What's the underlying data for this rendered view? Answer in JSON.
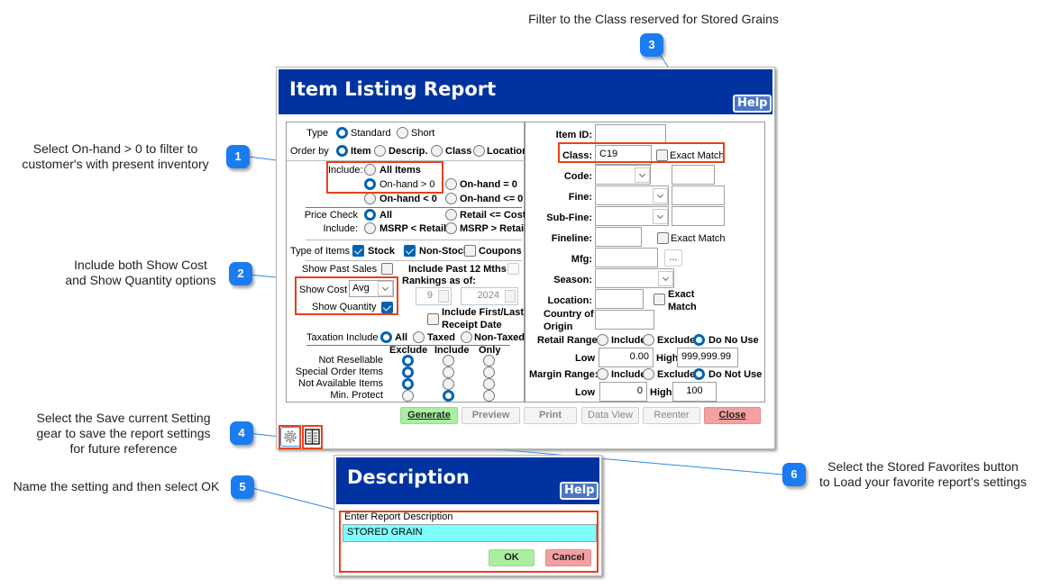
{
  "annotations": [
    {
      "number": "1",
      "text_line1": "Select On-hand > 0 to filter to",
      "text_line2": "customer's with present inventory"
    },
    {
      "number": "2",
      "text_line1": "Include both Show Cost",
      "text_line2": "and Show Quantity options"
    },
    {
      "number": "3",
      "text_line1": "Filter to the Class reserved for Stored Grains"
    },
    {
      "number": "4",
      "text_line1": "Select the Save current Setting",
      "text_line2": "gear to save the report settings",
      "text_line3": "for future reference"
    },
    {
      "number": "5",
      "text_line1": "Name the setting and then select OK"
    },
    {
      "number": "6",
      "text_line1": "Select the Stored Favorites button",
      "text_line2": "to Load your favorite report's settings"
    }
  ],
  "colors": {
    "titlebar": "#0033a0",
    "highlight": "#e8401c",
    "badge": "#1a7cf0",
    "generate": "#a8f0a0",
    "close": "#f4a0a0",
    "description_input": "#7ffcfc"
  },
  "window": {
    "title": "Item Listing Report",
    "help_label": "Help",
    "type": {
      "label": "Type",
      "options": [
        "Standard",
        "Short"
      ],
      "selected": "Standard"
    },
    "order_by": {
      "label": "Order by",
      "options": [
        "Item",
        "Descrip.",
        "Class",
        "Location"
      ],
      "selected": "Item"
    },
    "include": {
      "label": "Include:",
      "options": [
        "All Items",
        "On-hand > 0",
        "On-hand = 0",
        "On-hand < 0",
        "On-hand <= 0"
      ],
      "selected": "On-hand > 0"
    },
    "price_check": {
      "label1": "Price Check",
      "label2": "Include:",
      "options": [
        "All",
        "Retail <= Cost",
        "MSRP < Retail",
        "MSRP > Retail"
      ],
      "selected": "All"
    },
    "type_of_items": {
      "label": "Type of Items",
      "options": [
        {
          "label": "Stock",
          "checked": true
        },
        {
          "label": "Non-Stock",
          "checked": true
        },
        {
          "label": "Coupons",
          "checked": false
        }
      ]
    },
    "show_past_sales": {
      "label": "Show Past Sales",
      "checked": false
    },
    "include_past_12": {
      "label": "Include Past 12 Mths",
      "checked": false
    },
    "rankings": {
      "label": "Rankings as of:",
      "month": "9",
      "year": "2024"
    },
    "show_cost": {
      "label": "Show Cost",
      "value": "Avg"
    },
    "show_quantity": {
      "label": "Show Quantity",
      "checked": true
    },
    "include_first_last": {
      "label_line1": "Include First/Last",
      "label_line2": "Receipt Date",
      "checked": false
    },
    "taxation": {
      "label": "Taxation Include",
      "options": [
        "All",
        "Taxed",
        "Non-Taxed"
      ],
      "selected": "All"
    },
    "matrix": {
      "columns": [
        "Exclude",
        "Include",
        "Only"
      ],
      "rows": [
        {
          "label": "Not Resellable",
          "selected": "Exclude"
        },
        {
          "label": "Special  Order Items",
          "selected": "Exclude"
        },
        {
          "label": "Not  Available Items",
          "selected": "Exclude"
        },
        {
          "label": "Min. Protect",
          "selected": "Include"
        }
      ]
    },
    "right": {
      "item_id": {
        "label": "Item ID:",
        "value": ""
      },
      "class": {
        "label": "Class:",
        "value": "C19",
        "exact_label": "Exact Match",
        "exact": false
      },
      "code": {
        "label": "Code:",
        "value": ""
      },
      "fine": {
        "label": "Fine:",
        "value": ""
      },
      "sub_fine": {
        "label": "Sub-Fine:",
        "value": ""
      },
      "fineline": {
        "label": "Fineline:",
        "value": "",
        "exact_label": "Exact Match",
        "exact": false
      },
      "mfg": {
        "label": "Mfg:",
        "value": "",
        "browse_label": "..."
      },
      "season": {
        "label": "Season:",
        "value": ""
      },
      "location": {
        "label": "Location:",
        "value": "",
        "exact_line1": "Exact",
        "exact_line2": "Match",
        "exact": false
      },
      "country": {
        "label_line1": "Country of",
        "label_line2": "Origin",
        "value": ""
      },
      "retail_range": {
        "label": "Retail Range:",
        "options": [
          "Include",
          "Exclude",
          "Do No Use"
        ],
        "selected": "Do No Use",
        "low_label": "Low",
        "low": "0.00",
        "high_label": "High",
        "high": "999,999.99"
      },
      "margin_range": {
        "label": "Margin Range:",
        "options": [
          "Include",
          "Exclude",
          "Do Not Use"
        ],
        "selected": "Do Not Use",
        "low_label": "Low",
        "low": "0",
        "high_label": "High",
        "high": "100"
      }
    },
    "buttons": {
      "generate": "Generate",
      "preview": "Preview",
      "print": "Print",
      "data_view": "Data View",
      "reenter": "Reenter",
      "close": "Close"
    },
    "icons": {
      "save_setting": "gear-icon",
      "stored_favorites": "book-icon"
    }
  },
  "dialog": {
    "title": "Description",
    "help_label": "Help",
    "field_label": "Enter Report Description",
    "value": "STORED GRAIN",
    "ok_label": "OK",
    "cancel_label": "Cancel"
  }
}
